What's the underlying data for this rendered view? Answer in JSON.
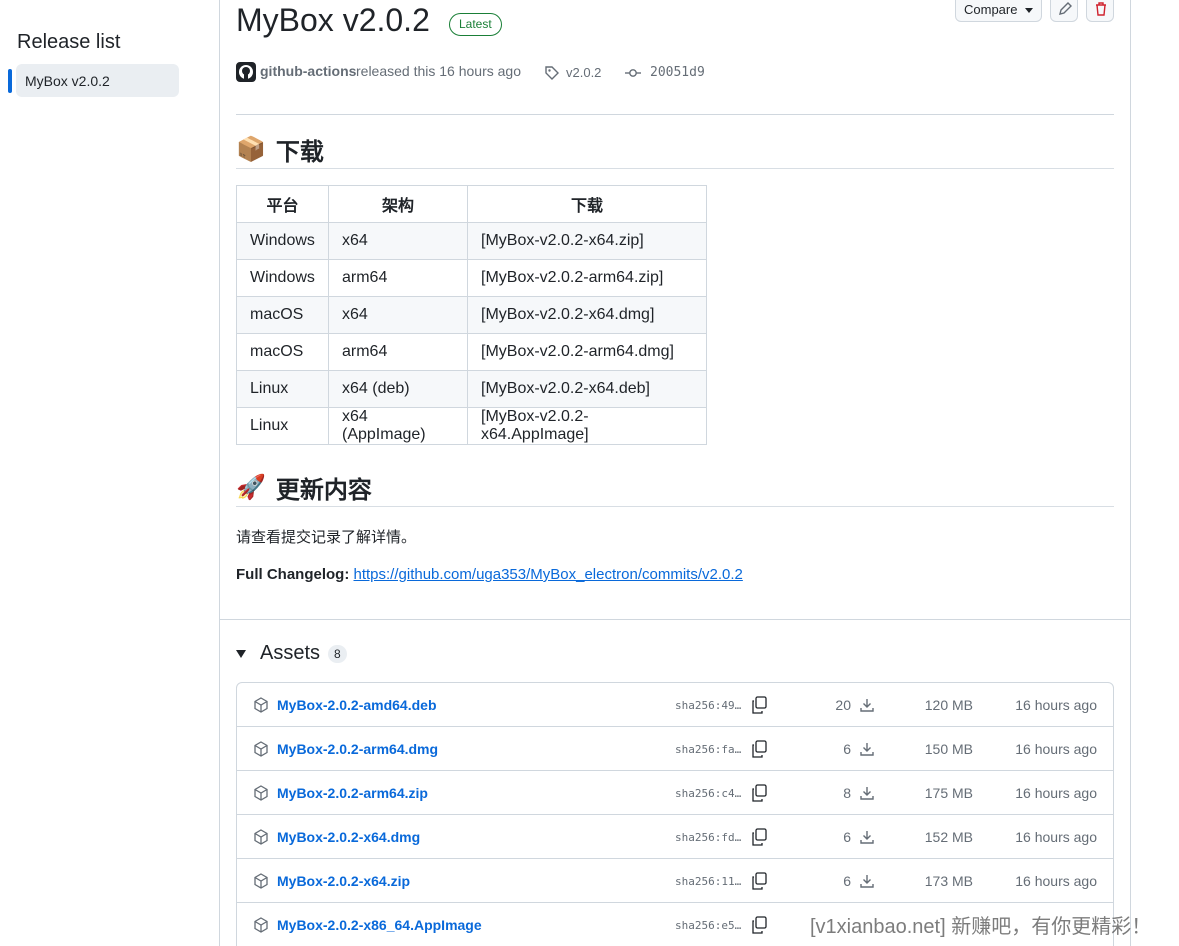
{
  "sidebar": {
    "title": "Release list",
    "items": [
      {
        "label": "MyBox v2.0.2",
        "active": true
      }
    ]
  },
  "release": {
    "title": "MyBox v2.0.2",
    "badge": "Latest",
    "compare_label": "Compare",
    "author": "github-actions",
    "released_text": "released this 16 hours ago",
    "tag": "v2.0.2",
    "commit": "20051d9"
  },
  "download_section": {
    "emoji": "📦",
    "heading": "下载",
    "headers": [
      "平台",
      "架构",
      "下载"
    ],
    "rows": [
      [
        "Windows",
        "x64",
        "[MyBox-v2.0.2-x64.zip]"
      ],
      [
        "Windows",
        "arm64",
        "[MyBox-v2.0.2-arm64.zip]"
      ],
      [
        "macOS",
        "x64",
        "[MyBox-v2.0.2-x64.dmg]"
      ],
      [
        "macOS",
        "arm64",
        "[MyBox-v2.0.2-arm64.dmg]"
      ],
      [
        "Linux",
        "x64 (deb)",
        "[MyBox-v2.0.2-x64.deb]"
      ],
      [
        "Linux",
        "x64 (AppImage)",
        "[MyBox-v2.0.2-x64.AppImage]"
      ]
    ]
  },
  "updates_section": {
    "emoji": "🚀",
    "heading": "更新内容",
    "text": "请查看提交记录了解详情。",
    "changelog_label": "Full Changelog:",
    "changelog_url": "https://github.com/uga353/MyBox_electron/commits/v2.0.2"
  },
  "assets": {
    "title": "Assets",
    "count": "8",
    "items": [
      {
        "name": "MyBox-2.0.2-amd64.deb",
        "sha": "sha256:49…",
        "downloads": "20",
        "size": "120 MB",
        "time": "16 hours ago"
      },
      {
        "name": "MyBox-2.0.2-arm64.dmg",
        "sha": "sha256:fa…",
        "downloads": "6",
        "size": "150 MB",
        "time": "16 hours ago"
      },
      {
        "name": "MyBox-2.0.2-arm64.zip",
        "sha": "sha256:c4…",
        "downloads": "8",
        "size": "175 MB",
        "time": "16 hours ago"
      },
      {
        "name": "MyBox-2.0.2-x64.dmg",
        "sha": "sha256:fd…",
        "downloads": "6",
        "size": "152 MB",
        "time": "16 hours ago"
      },
      {
        "name": "MyBox-2.0.2-x64.zip",
        "sha": "sha256:11…",
        "downloads": "6",
        "size": "173 MB",
        "time": "16 hours ago"
      },
      {
        "name": "MyBox-2.0.2-x86_64.AppImage",
        "sha": "sha256:e5…",
        "downloads": "",
        "size": "",
        "time": ""
      }
    ]
  },
  "watermark": "[v1xianbao.net] 新赚吧，有你更精彩！"
}
